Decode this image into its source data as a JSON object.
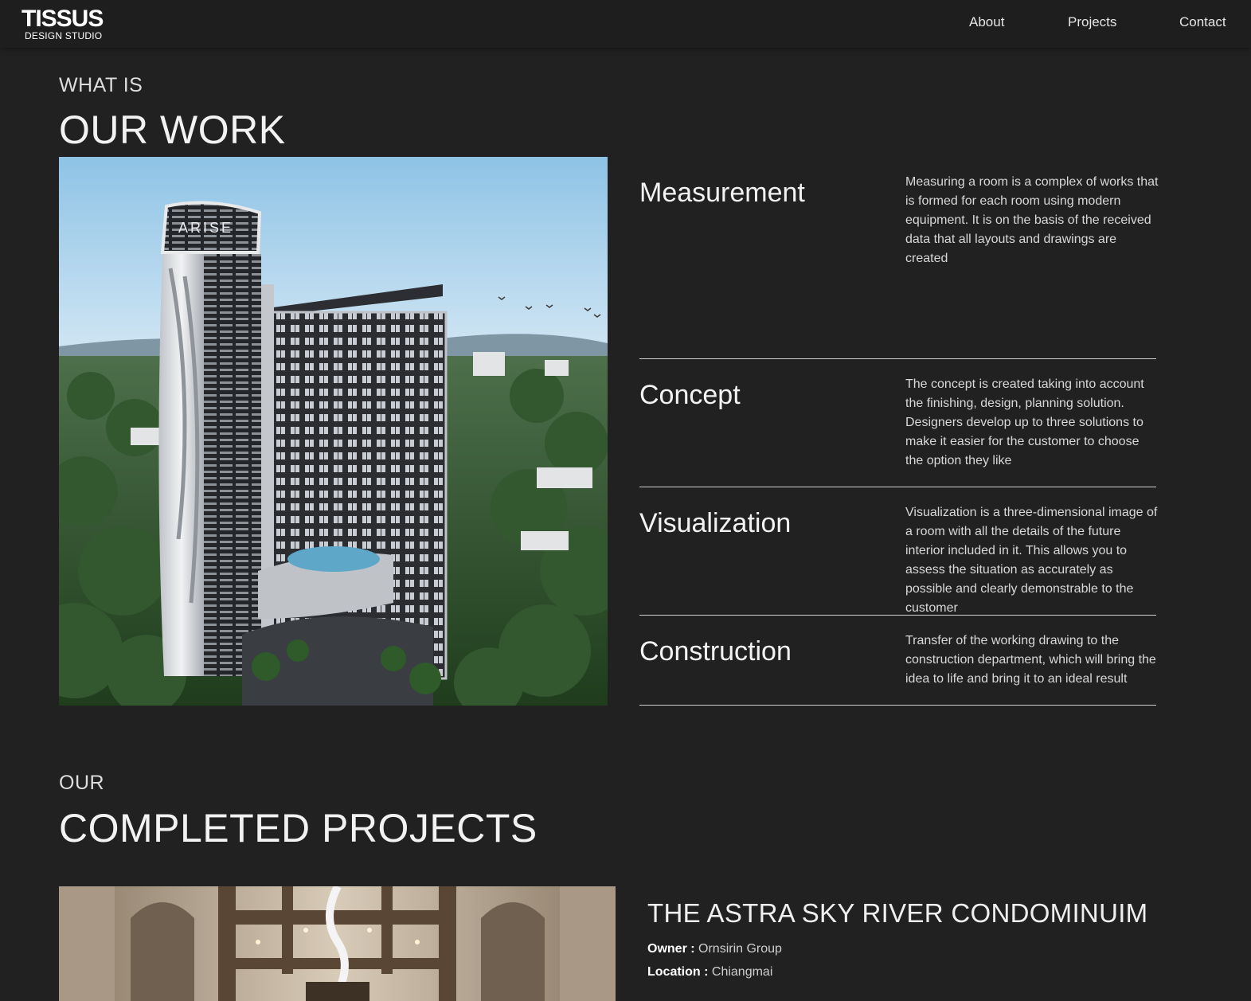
{
  "header": {
    "logo_main": "TISSUS",
    "logo_sub": "DESIGN  STUDIO",
    "nav": [
      {
        "label": "About"
      },
      {
        "label": "Projects"
      },
      {
        "label": "Contact"
      }
    ]
  },
  "work": {
    "eyebrow": "WHAT IS",
    "title": "OUR WORK",
    "hero_signage": "ARISE",
    "steps": [
      {
        "title": "Measurement",
        "text": "Measuring a room is a complex of works that is formed for each room using modern equipment. It is on the basis of the received data that all layouts and drawings are created"
      },
      {
        "title": "Concept",
        "text": "The concept is created taking into account the finishing, design, planning solution. Designers develop up to three solutions to make it easier for the customer to choose the option they like"
      },
      {
        "title": "Visualization",
        "text": "Visualization is a three-dimensional image of a room with all the details of the future interior included in it. This allows you to assess the situation as accurately as possible and clearly demonstrable to the customer"
      },
      {
        "title": "Construction",
        "text": "Transfer of the working drawing to the construction department, which will bring the idea to life and bring it to an ideal result"
      }
    ]
  },
  "projects": {
    "eyebrow": "OUR",
    "title": "COMPLETED PROJECTS",
    "items": [
      {
        "name": "THE ASTRA SKY RIVER CONDOMINUIM",
        "owner_label": "Owner :",
        "owner": "Ornsirin Group",
        "location_label": "Location :",
        "location": "Chiangmai"
      }
    ]
  },
  "colors": {
    "background": "#212121",
    "header": "#1e1e1e",
    "text": "#eaeaea",
    "divider": "#cfcfcf"
  }
}
